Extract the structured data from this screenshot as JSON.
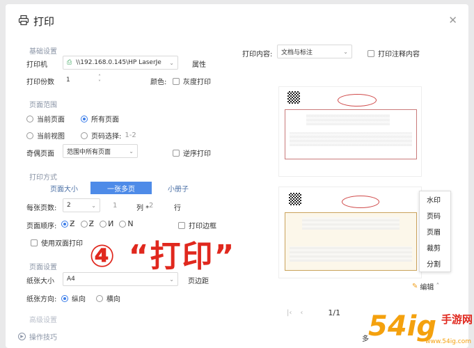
{
  "dialog": {
    "title": "打印"
  },
  "basic": {
    "section": "基础设置",
    "printer_label": "打印机",
    "printer_value": "\\\\192.168.0.145\\HP LaserJe",
    "properties": "属性",
    "copies_label": "打印份数",
    "copies_value": "1",
    "color_label": "颜色:",
    "grayscale_label": "灰度打印"
  },
  "print_content": {
    "label": "打印内容:",
    "value": "文档与标注",
    "annotation_label": "打印注释内容"
  },
  "range": {
    "section": "页面范围",
    "current_page": "当前页面",
    "all_pages": "所有页面",
    "current_view": "当前视图",
    "page_select_label": "页码选择:",
    "page_select_value": "1-2",
    "odd_even_label": "奇偶页面",
    "odd_even_value": "范围中所有页面",
    "reverse_label": "逆序打印"
  },
  "mode": {
    "section": "打印方式",
    "tabs": [
      "页面大小",
      "一张多页",
      "小册子"
    ],
    "per_sheet_label": "每张页数:",
    "per_sheet_value": "2",
    "rows_value": "1",
    "col_label": "列 *",
    "col_value": "2",
    "row_label": "行",
    "order_label": "页面顺序:",
    "border_label": "打印边框",
    "duplex_label": "使用双面打印"
  },
  "page_setup": {
    "section": "页面设置",
    "paper_label": "纸张大小",
    "paper_value": "A4",
    "margin_label": "页边距",
    "orientation_label": "纸张方向:",
    "portrait": "纵向",
    "landscape": "横向",
    "advanced_section": "高级设置"
  },
  "footer": {
    "tips": "操作技巧",
    "more": "多"
  },
  "pager": {
    "page": "1/1"
  },
  "context_menu": {
    "items": [
      "水印",
      "页码",
      "页眉",
      "裁剪",
      "分割"
    ],
    "edit": "编辑"
  },
  "overlay": {
    "text": "④ “打印”"
  },
  "watermark": {
    "big": "54ig",
    "small": "手游网",
    "url": "www.54ig.com"
  },
  "colors": {
    "accent": "#4e8be8",
    "overlay": "#e0281e",
    "watermark": "#f4a10e"
  }
}
